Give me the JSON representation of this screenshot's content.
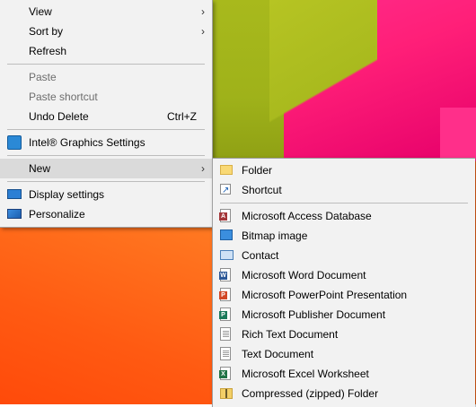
{
  "context_menu": {
    "items": [
      {
        "label": "View",
        "arrow": "›"
      },
      {
        "label": "Sort by",
        "arrow": "›"
      },
      {
        "label": "Refresh"
      },
      {
        "label": "Paste"
      },
      {
        "label": "Paste shortcut"
      },
      {
        "label": "Undo Delete",
        "shortcut": "Ctrl+Z"
      },
      {
        "label": "Intel® Graphics Settings",
        "icon": "intel-graphics-icon"
      },
      {
        "label": "New",
        "arrow": "›"
      },
      {
        "label": "Display settings",
        "icon": "display-icon"
      },
      {
        "label": "Personalize",
        "icon": "personalize-icon"
      }
    ]
  },
  "new_submenu": {
    "items": [
      {
        "label": "Folder",
        "icon": "folder-icon"
      },
      {
        "label": "Shortcut",
        "icon": "shortcut-icon"
      },
      {
        "label": "Microsoft Access Database",
        "icon": "access-icon"
      },
      {
        "label": "Bitmap image",
        "icon": "bitmap-icon"
      },
      {
        "label": "Contact",
        "icon": "contact-icon"
      },
      {
        "label": "Microsoft Word Document",
        "icon": "word-icon"
      },
      {
        "label": "Microsoft PowerPoint Presentation",
        "icon": "powerpoint-icon"
      },
      {
        "label": "Microsoft Publisher Document",
        "icon": "publisher-icon"
      },
      {
        "label": "Rich Text Document",
        "icon": "rtf-icon"
      },
      {
        "label": "Text Document",
        "icon": "text-icon"
      },
      {
        "label": "Microsoft Excel Worksheet",
        "icon": "excel-icon"
      },
      {
        "label": "Compressed (zipped) Folder",
        "icon": "zip-folder-icon"
      }
    ]
  },
  "colors": {
    "menu_background": "#f2f2f2",
    "highlight": "#dadada",
    "disabled_text": "#6d6d6d"
  }
}
